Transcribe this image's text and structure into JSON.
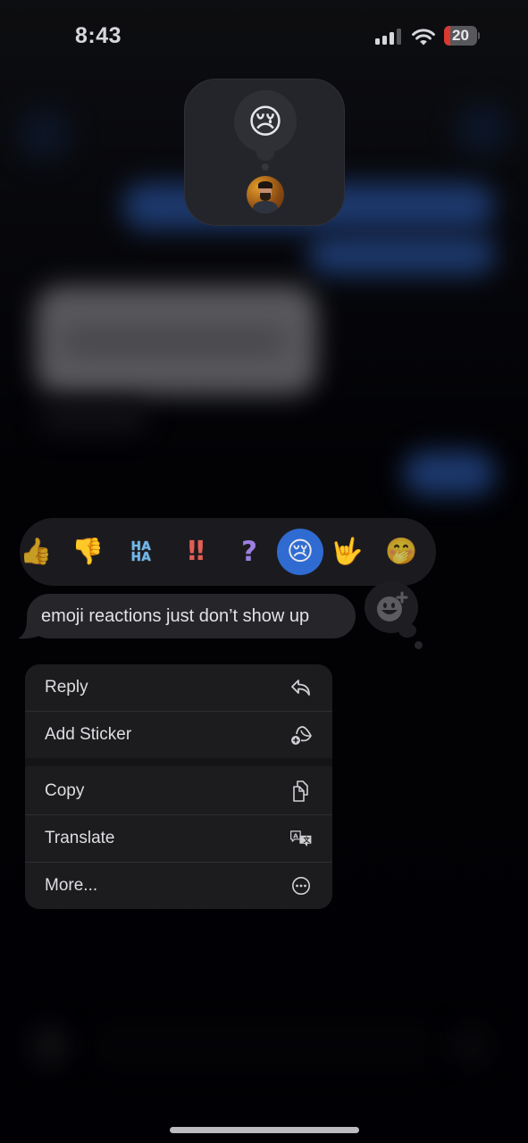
{
  "status_bar": {
    "time": "8:43",
    "signal_bars_active": 3,
    "signal_bars_total": 4,
    "wifi_icon": "wifi-icon",
    "battery_percent": 20,
    "battery_label": "20",
    "battery_color": "#d9392f"
  },
  "reaction_summary": {
    "emoji": "😢",
    "reactor_avatar": "avatar"
  },
  "tapback_bar": {
    "items": [
      {
        "name": "thumbs-up",
        "glyph": "👍",
        "selected": false
      },
      {
        "name": "thumbs-down",
        "glyph": "👎",
        "selected": false
      },
      {
        "name": "haha",
        "line1": "HA",
        "line2": "HA",
        "selected": false
      },
      {
        "name": "exclamation",
        "glyph": "‼",
        "selected": false
      },
      {
        "name": "question",
        "glyph": "?",
        "selected": false
      },
      {
        "name": "crying-face",
        "glyph": "😢",
        "selected": true
      },
      {
        "name": "love-you-gesture",
        "glyph": "🤟",
        "selected": false
      },
      {
        "name": "smiling-face-with-hand-over-mouth",
        "glyph": "🤭",
        "selected": false
      }
    ],
    "selected_color": "#2f6bd1",
    "add_sticker_icon": "smiley-plus-icon"
  },
  "message": {
    "text": "emoji reactions just don’t show up"
  },
  "context_menu": {
    "items": [
      {
        "label": "Reply",
        "icon": "reply-arrow-icon"
      },
      {
        "label": "Add Sticker",
        "icon": "sticker-add-icon"
      },
      {
        "label": "Copy",
        "icon": "copy-documents-icon"
      },
      {
        "label": "Translate",
        "icon": "translate-icon"
      },
      {
        "label": "More...",
        "icon": "ellipsis-circle-icon"
      }
    ]
  }
}
